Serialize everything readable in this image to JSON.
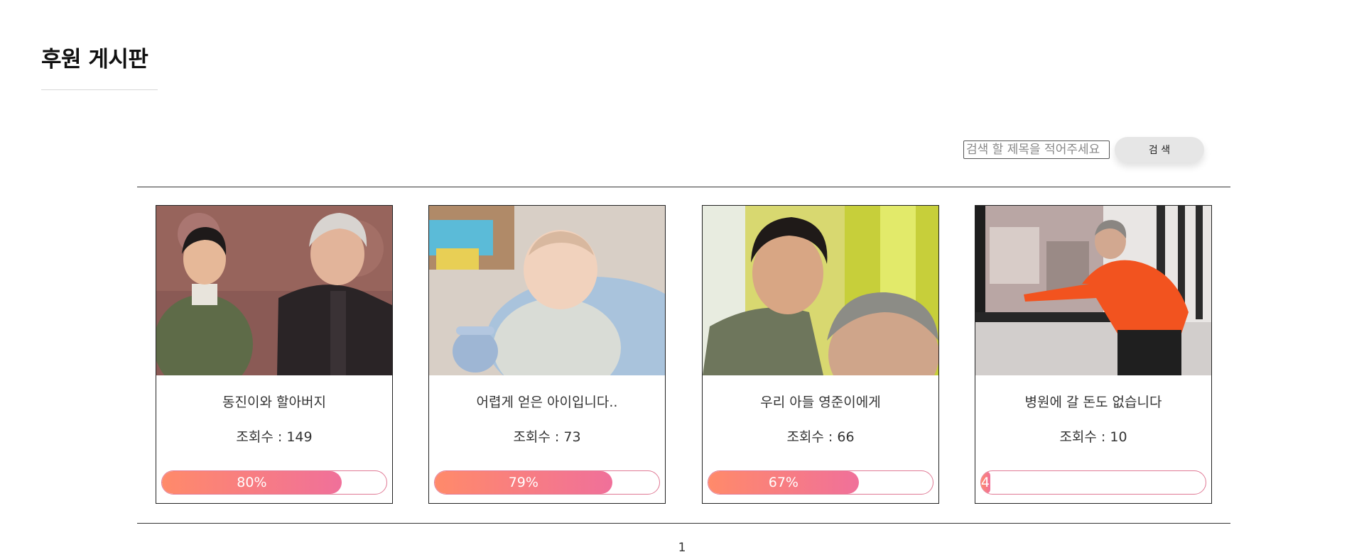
{
  "header": {
    "title": "후원 게시판"
  },
  "search": {
    "placeholder": "검색 할 제목을 적어주세요",
    "button_label": "검 색"
  },
  "posts": [
    {
      "title": "동진이와 할아버지",
      "views": "조회수 : 149",
      "progress_label": "80%",
      "progress_fraction": 0.8
    },
    {
      "title": "어렵게 얻은 아이입니다..",
      "views": "조회수 : 73",
      "progress_label": "79%",
      "progress_fraction": 0.79
    },
    {
      "title": "우리 아들 영준이에게",
      "views": "조회수 : 66",
      "progress_label": "67%",
      "progress_fraction": 0.67
    },
    {
      "title": "병원에 갈 돈도 없습니다",
      "views": "조회수 : 10",
      "progress_label": "4%",
      "progress_fraction": 0.04
    }
  ],
  "pagination": {
    "current": "1"
  },
  "colors": {
    "progress_start": "#ff8a6a",
    "progress_end": "#f0709a",
    "progress_border": "#e07a95"
  }
}
